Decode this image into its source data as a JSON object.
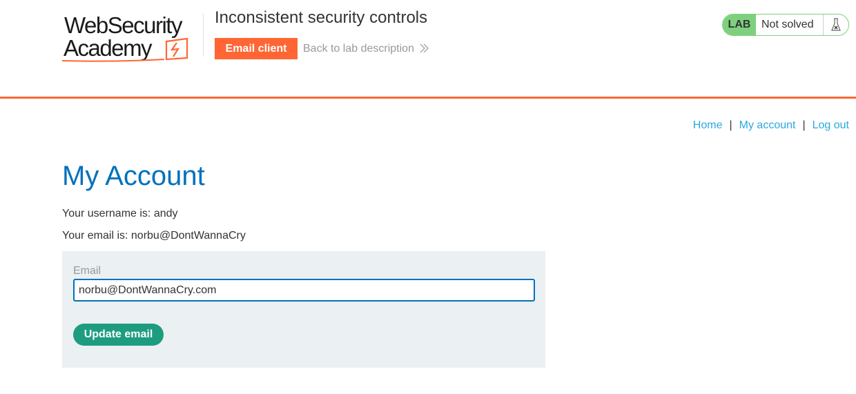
{
  "header": {
    "logo": {
      "line1": "WebSecurity",
      "line2": "Academy"
    },
    "lab_title": "Inconsistent security controls",
    "email_client_label": "Email client",
    "back_link_label": "Back to lab description",
    "lab_badge": "LAB",
    "lab_status": "Not solved"
  },
  "nav": {
    "items": [
      {
        "label": "Home"
      },
      {
        "label": "My account"
      },
      {
        "label": "Log out"
      }
    ],
    "separator": "|"
  },
  "main": {
    "title": "My Account",
    "username_line": "Your username is: andy",
    "email_line": "Your email is: norbu@DontWannaCry",
    "form": {
      "email_label": "Email",
      "email_value": "norbu@DontWannaCry.com",
      "submit_label": "Update email"
    }
  },
  "colors": {
    "accent_orange": "#ff6633",
    "title_blue": "#0071bc",
    "link_blue": "#29a8e0",
    "button_green": "#1e9c7f",
    "lab_green": "#7ed07e",
    "panel_bg": "#ebf0f2"
  },
  "icons": {
    "back_chevron": "double-chevron-right-icon",
    "lab_flask": "flask-icon",
    "logo_bolt": "lightning-bolt-icon"
  }
}
